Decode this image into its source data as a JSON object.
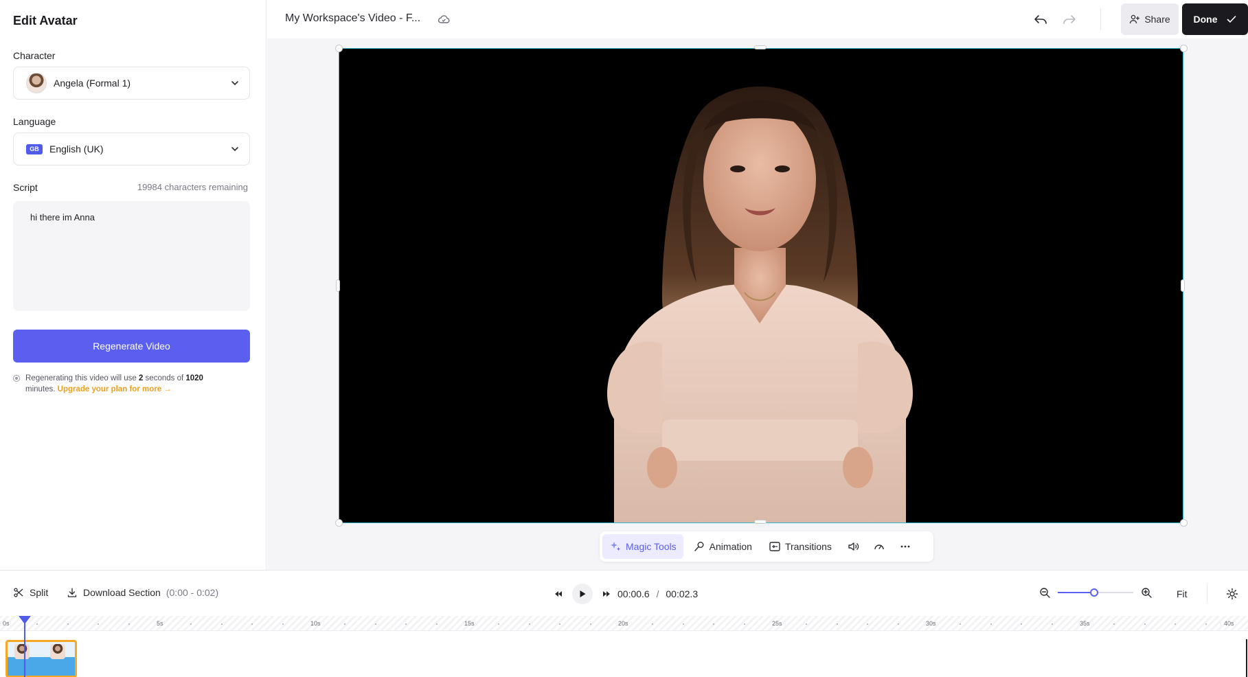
{
  "sidebar": {
    "title": "Edit Avatar",
    "character": {
      "label": "Character",
      "value": "Angela (Formal 1)"
    },
    "language": {
      "label": "Language",
      "flag": "GB",
      "value": "English (UK)"
    },
    "script": {
      "label": "Script",
      "remaining": "19984 characters remaining",
      "text": "hi there im Anna"
    },
    "regenerate_label": "Regenerate Video",
    "note": {
      "prefix": "Regenerating this video will use",
      "seconds": "2",
      "middle": "seconds of",
      "minutes": "1020",
      "suffix": "minutes.",
      "upgrade": "Upgrade your plan for more →"
    }
  },
  "topbar": {
    "project_title": "My Workspace's Video - F...",
    "share_label": "Share",
    "done_label": "Done"
  },
  "toolbar": {
    "magic_tools": "Magic Tools",
    "animation": "Animation",
    "transitions": "Transitions"
  },
  "timeline": {
    "split_label": "Split",
    "download_label": "Download Section",
    "download_range": "(0:00 - 0:02)",
    "current_time": "00:00.6",
    "separator": "/",
    "total_time": "00:02.3",
    "fit_label": "Fit",
    "zoom_level": 0.48,
    "ruler_labels": [
      "0s",
      "5s",
      "10s",
      "15s",
      "20s",
      "25s",
      "30s",
      "35s",
      "40s"
    ]
  },
  "colors": {
    "accent": "#5a5ff0",
    "selection_border": "#2fb7c9",
    "clip_border": "#f5a623",
    "upgrade_link": "#f0a020"
  }
}
